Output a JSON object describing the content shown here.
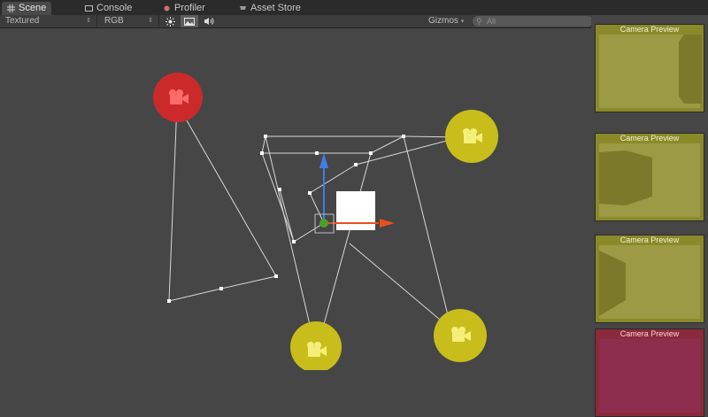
{
  "tabs": [
    {
      "label": "Scene",
      "icon": "grid-icon",
      "active": true
    },
    {
      "label": "Console",
      "icon": "console-icon",
      "active": false
    },
    {
      "label": "Profiler",
      "icon": "profiler-icon",
      "active": false
    },
    {
      "label": "Asset Store",
      "icon": "shopping-cart-icon",
      "active": false
    }
  ],
  "toolbar": {
    "render_mode": "Textured",
    "color_mode": "RGB",
    "lighting_icon": "sun-icon",
    "image_icon": "image-icon",
    "audio_icon": "speaker-icon",
    "gizmos_label": "Gizmos",
    "search_placeholder": "All"
  },
  "previews": [
    {
      "title": "Camera Preview",
      "color": "#b8b030"
    },
    {
      "title": "Camera Preview",
      "color": "#b8b030"
    },
    {
      "title": "Camera Preview",
      "color": "#b8b030"
    },
    {
      "title": "Camera Preview",
      "color": "#c0305a"
    }
  ],
  "colors": {
    "selected_camera": "#cc2a2a",
    "camera": "#c9bd1c",
    "axis_y": "#3f7ee8",
    "axis_x": "#e8501e",
    "center": "#4aa02a"
  }
}
